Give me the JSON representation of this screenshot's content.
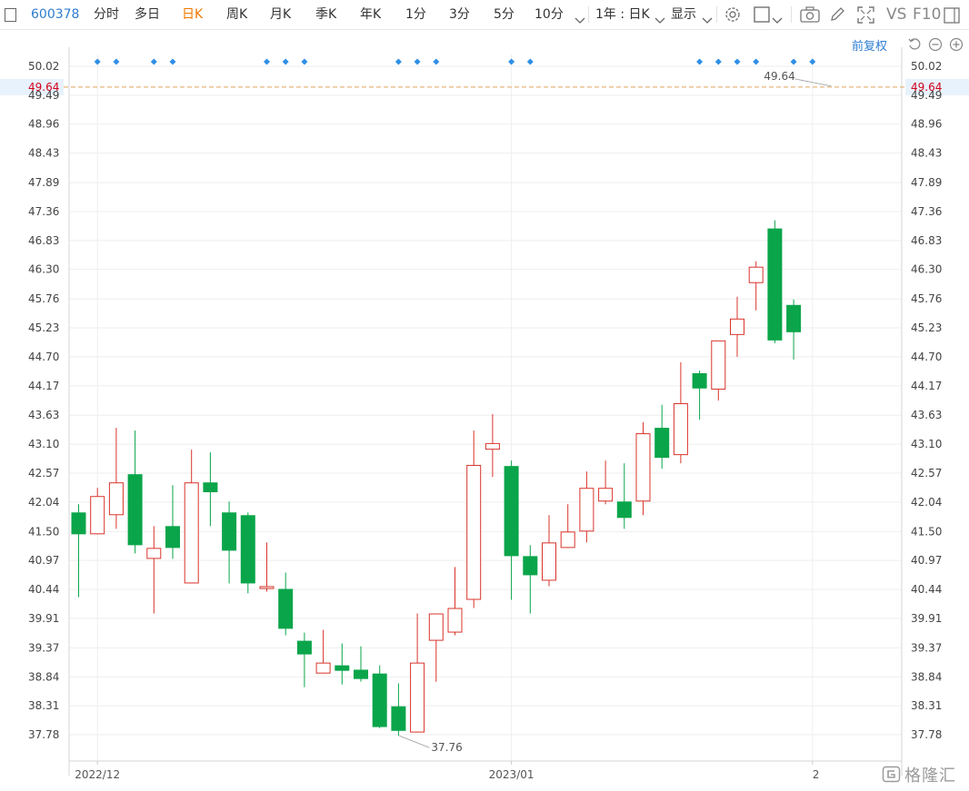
{
  "toolbar": {
    "stock_code": "600378",
    "period_tabs": [
      "分时",
      "多日",
      "日K",
      "周K",
      "月K",
      "季K",
      "年K",
      "1分",
      "3分",
      "5分",
      "10分"
    ],
    "active_tab": "日K",
    "range_select": "1年 : 日K",
    "display_menu": "显示",
    "vs_label": "VS",
    "f10_label": "F10",
    "icons": [
      "checkbox-icon",
      "chevron-down-icon",
      "settings-gear-icon",
      "square-checkbox-icon",
      "camera-icon",
      "pencil-icon",
      "fullscreen-icon",
      "window-icon"
    ]
  },
  "adjust_label": "前复权",
  "controls": [
    "reset-icon",
    "zoom-out-icon",
    "zoom-in-icon"
  ],
  "watermark": "格隆汇",
  "colors": {
    "up": "#d9342b",
    "down": "#0aa54a",
    "accent": "#2f7dd1",
    "price_line": "#e0a35e",
    "current_price_text": "#d0021b"
  },
  "chart_data": {
    "type": "candlestick",
    "y_ticks": [
      "50.02",
      "49.49",
      "48.96",
      "48.43",
      "47.89",
      "47.36",
      "46.83",
      "46.30",
      "45.76",
      "45.23",
      "44.70",
      "44.17",
      "43.63",
      "43.10",
      "42.57",
      "42.04",
      "41.50",
      "40.97",
      "40.44",
      "39.91",
      "39.37",
      "38.84",
      "38.31",
      "37.78"
    ],
    "ylim": [
      37.78,
      50.02
    ],
    "date_labels": [
      {
        "label": "2022/12",
        "index": 1
      },
      {
        "label": "2023/01",
        "index": 23
      },
      {
        "label": "2",
        "index": 39
      }
    ],
    "current_price": "49.64",
    "annotations": [
      {
        "text": "37.76",
        "index": 17,
        "value": 37.76,
        "kind": "low"
      },
      {
        "text": "49.64",
        "index": 37,
        "value": 49.64,
        "kind": "price"
      }
    ],
    "marker_indices": [
      1,
      2,
      4,
      5,
      10,
      11,
      12,
      17,
      18,
      19,
      23,
      24,
      33,
      34,
      35,
      36,
      38,
      39
    ],
    "candles": [
      {
        "o": 41.85,
        "h": 42.0,
        "l": 40.3,
        "c": 41.45
      },
      {
        "o": 41.45,
        "h": 42.3,
        "l": 41.45,
        "c": 42.15
      },
      {
        "o": 41.8,
        "h": 43.4,
        "l": 41.55,
        "c": 42.4
      },
      {
        "o": 42.55,
        "h": 43.35,
        "l": 41.1,
        "c": 41.25
      },
      {
        "o": 41.0,
        "h": 41.6,
        "l": 40.0,
        "c": 41.2
      },
      {
        "o": 41.6,
        "h": 42.35,
        "l": 41.0,
        "c": 41.2
      },
      {
        "o": 40.55,
        "h": 43.0,
        "l": 40.55,
        "c": 42.4
      },
      {
        "o": 42.4,
        "h": 42.95,
        "l": 41.6,
        "c": 42.22
      },
      {
        "o": 41.85,
        "h": 42.05,
        "l": 40.55,
        "c": 41.15
      },
      {
        "o": 41.8,
        "h": 41.85,
        "l": 40.37,
        "c": 40.55
      },
      {
        "o": 40.45,
        "h": 41.3,
        "l": 40.4,
        "c": 40.5
      },
      {
        "o": 40.45,
        "h": 40.75,
        "l": 39.6,
        "c": 39.72
      },
      {
        "o": 39.5,
        "h": 39.65,
        "l": 38.65,
        "c": 39.25
      },
      {
        "o": 38.9,
        "h": 39.7,
        "l": 38.9,
        "c": 39.1
      },
      {
        "o": 39.05,
        "h": 39.45,
        "l": 38.7,
        "c": 38.95
      },
      {
        "o": 38.97,
        "h": 39.4,
        "l": 38.75,
        "c": 38.8
      },
      {
        "o": 38.9,
        "h": 39.05,
        "l": 37.9,
        "c": 37.92
      },
      {
        "o": 38.3,
        "h": 38.72,
        "l": 37.76,
        "c": 37.85
      },
      {
        "o": 37.82,
        "h": 40.0,
        "l": 37.82,
        "c": 39.1
      },
      {
        "o": 39.5,
        "h": 40.0,
        "l": 38.75,
        "c": 40.0
      },
      {
        "o": 39.65,
        "h": 40.85,
        "l": 39.6,
        "c": 40.1
      },
      {
        "o": 40.25,
        "h": 43.35,
        "l": 40.1,
        "c": 42.72
      },
      {
        "o": 43.0,
        "h": 43.65,
        "l": 42.5,
        "c": 43.12
      },
      {
        "o": 42.7,
        "h": 42.8,
        "l": 40.25,
        "c": 41.05
      },
      {
        "o": 41.05,
        "h": 41.25,
        "l": 40.0,
        "c": 40.7
      },
      {
        "o": 40.6,
        "h": 41.8,
        "l": 40.5,
        "c": 41.3
      },
      {
        "o": 41.2,
        "h": 42.0,
        "l": 41.2,
        "c": 41.5
      },
      {
        "o": 41.5,
        "h": 42.6,
        "l": 41.3,
        "c": 42.3
      },
      {
        "o": 42.05,
        "h": 42.8,
        "l": 42.0,
        "c": 42.3
      },
      {
        "o": 42.05,
        "h": 42.75,
        "l": 41.55,
        "c": 41.75
      },
      {
        "o": 42.05,
        "h": 43.5,
        "l": 41.8,
        "c": 43.3
      },
      {
        "o": 43.4,
        "h": 43.82,
        "l": 42.65,
        "c": 42.85
      },
      {
        "o": 42.9,
        "h": 44.6,
        "l": 42.75,
        "c": 43.85
      },
      {
        "o": 44.4,
        "h": 44.45,
        "l": 43.55,
        "c": 44.12
      },
      {
        "o": 44.1,
        "h": 45.0,
        "l": 43.9,
        "c": 45.0
      },
      {
        "o": 45.1,
        "h": 45.8,
        "l": 44.7,
        "c": 45.4
      },
      {
        "o": 46.05,
        "h": 46.45,
        "l": 45.55,
        "c": 46.35
      },
      {
        "o": 47.05,
        "h": 47.2,
        "l": 44.95,
        "c": 45.0
      },
      {
        "o": 45.65,
        "h": 45.75,
        "l": 44.65,
        "c": 45.15
      }
    ]
  }
}
